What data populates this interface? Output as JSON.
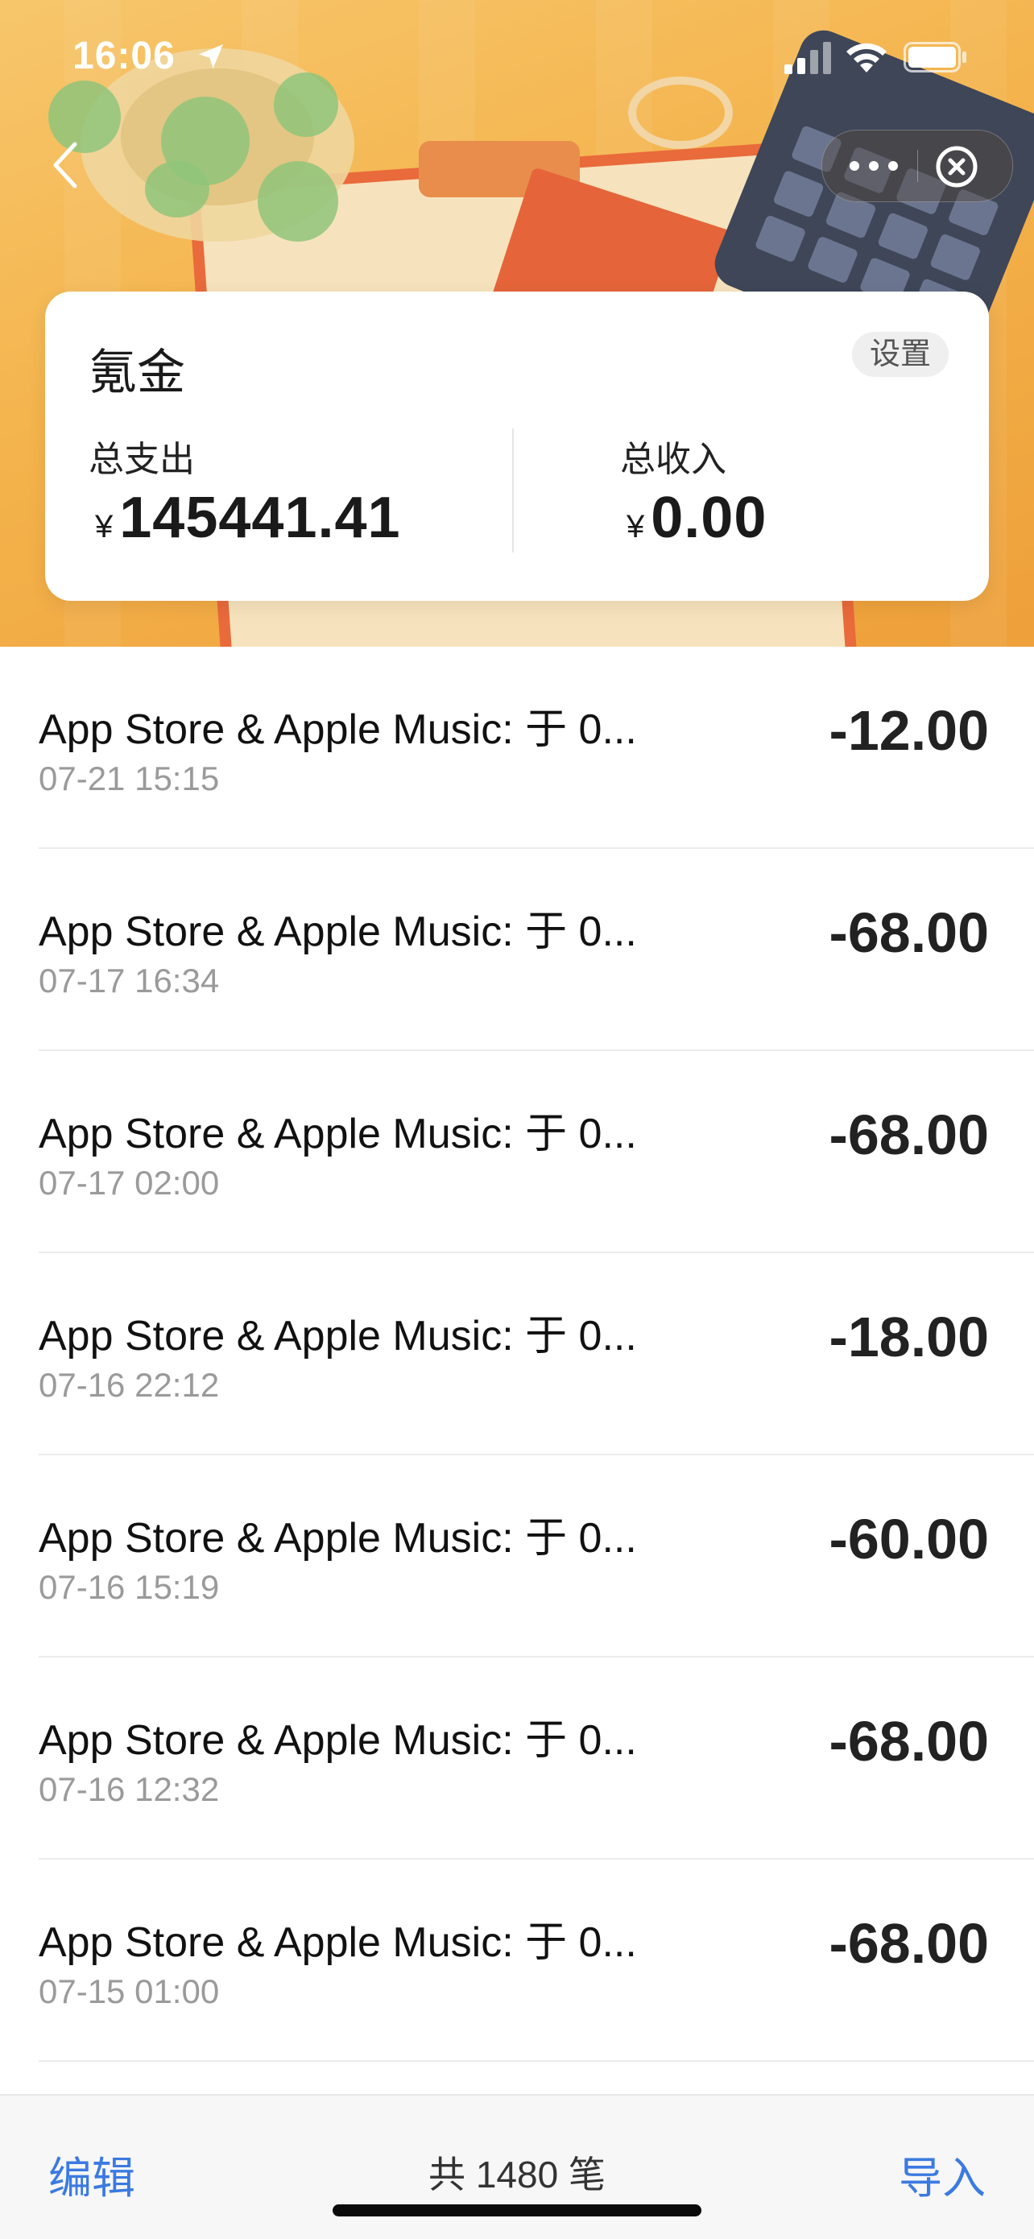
{
  "status_bar": {
    "time": "16:06"
  },
  "card": {
    "title": "氪金",
    "settings_label": "设置",
    "expense_label": "总支出",
    "expense_currency": "¥",
    "expense_amount": "145441.41",
    "income_label": "总收入",
    "income_currency": "¥",
    "income_amount": "0.00"
  },
  "transactions": [
    {
      "desc": "App Store & Apple Music: 于 0...",
      "date": "07-21 15:15",
      "amount": "-12.00"
    },
    {
      "desc": "App Store & Apple Music: 于 0...",
      "date": "07-17 16:34",
      "amount": "-68.00"
    },
    {
      "desc": "App Store & Apple Music: 于 0...",
      "date": "07-17 02:00",
      "amount": "-68.00"
    },
    {
      "desc": "App Store & Apple Music: 于 0...",
      "date": "07-16 22:12",
      "amount": "-18.00"
    },
    {
      "desc": "App Store & Apple Music: 于 0...",
      "date": "07-16 15:19",
      "amount": "-60.00"
    },
    {
      "desc": "App Store & Apple Music: 于 0...",
      "date": "07-16 12:32",
      "amount": "-68.00"
    },
    {
      "desc": "App Store & Apple Music: 于 0...",
      "date": "07-15 01:00",
      "amount": "-68.00"
    }
  ],
  "bottom_bar": {
    "edit_label": "编辑",
    "count_label": "共 1480 笔",
    "import_label": "导入"
  },
  "colors": {
    "accent": "#3b7ae0",
    "header_bg": "#f4b34c"
  },
  "icons": [
    "back-icon",
    "more-icon",
    "close-icon",
    "location-icon",
    "signal-icon",
    "wifi-icon",
    "battery-icon"
  ]
}
